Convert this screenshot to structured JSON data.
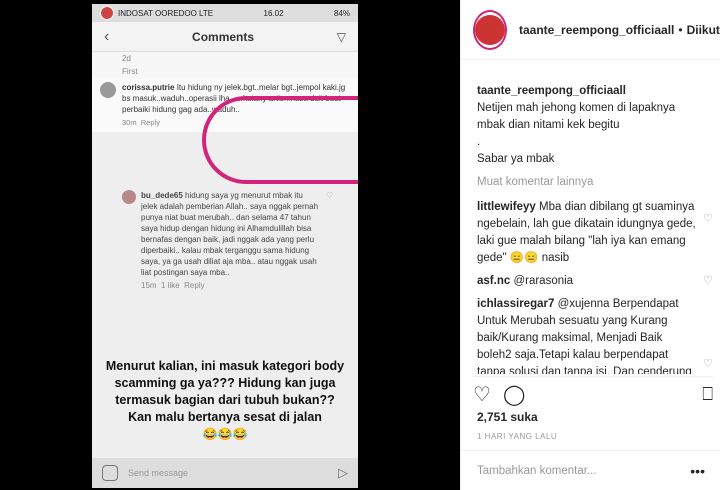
{
  "story": {
    "carrier": "INDOSAT OOREDOO LTE",
    "time": "16.02",
    "battery": "84%",
    "header_title": "Comments",
    "meta_time": "2d",
    "meta_first": "First",
    "comment1": {
      "user": "corissa.putrie",
      "text": "Itu hidung ny jelek.bgt..melar bgt..jempol kaki.jg bs masuk..waduh..operasii lha......katany artis..masa duit buat perbaiki hidung gag ada..waduh..",
      "time": "30m",
      "reply": "Reply"
    },
    "comment2": {
      "user": "bu_dede65",
      "text": "hidung saya yg menurut mbak itu jelek adalah pemberian Allah.. saya nggak pernah punya niat buat merubah.. dan selama 47 tahun saya hidup dengan hidung ini Alhamdulillah bisa bernafas dengan baik, jadi nggak ada yang perlu diperbaiki.. kalau mbak terganggu sama hidung saya, ya ga usah diliat aja mba.. atau nggak usah liat postingan saya mba..",
      "time": "15m",
      "likes": "1 like",
      "reply": "Reply"
    },
    "caption": "Menurut kalian, ini masuk kategori body scamming ga ya??? Hidung kan juga termasuk bagian dari tubuh bukan?? Kan malu bertanya sesat di jalan",
    "caption_emoji": "😂😂😂",
    "footer_placeholder": "Send message"
  },
  "post": {
    "username": "taante_reempong_officiaall",
    "dot": "•",
    "follow_label": "Diikuti",
    "comments": [
      {
        "user": "taante_reempong_officiaall",
        "text": "Netijen mah jehong komen di lapaknya mbak dian nitami kek begitu\n.\nSabar ya mbak"
      },
      {
        "user": "littlewifeyy",
        "text": "Mba dian dibilang gt suaminya ngebelain, lah gue dikatain idungnya gede, laki gue malah bilang \"lah iya kan emang gede\" 😑😑 nasib"
      },
      {
        "user": "asf.nc",
        "text": "@rarasonia"
      },
      {
        "user": "ichlassiregar7",
        "text": "@xujenna Berpendapat Untuk Merubah sesuatu yang Kurang baik/Kurang maksimal, Menjadi Baik boleh2 saja.Tetapi kalau berpendapat tanpa solusi dan tanpa isi, Dan cenderung ke penghinaan. Itu tidak termasuk Pendapat, Itu sudah Dikategorikan ke penghinaan"
      }
    ],
    "more_comments": "Muat komentar lainnya",
    "likes": "2,751 suka",
    "time_ago": "1 HARI YANG LALU",
    "add_comment_placeholder": "Tambahkan komentar...",
    "dots": "•••"
  },
  "colors": {
    "highlight": "#d1247a",
    "link": "#00376b"
  }
}
